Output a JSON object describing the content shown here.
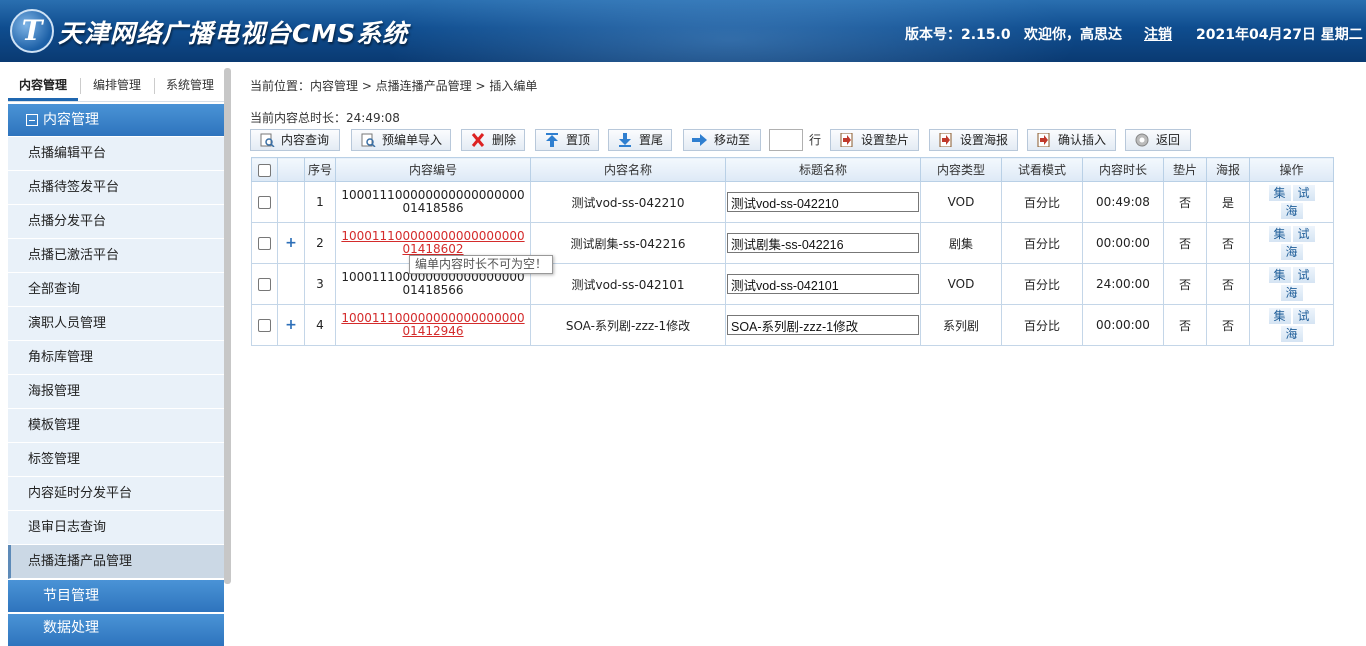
{
  "header": {
    "logo_letter": "T",
    "title": "天津网络广播电视台CMS系统",
    "version_label": "版本号：2.15.0",
    "welcome": "欢迎你，高思达",
    "logout": "注销",
    "date": "2021年04月27日 星期二"
  },
  "sidebar": {
    "tabs": [
      "内容管理",
      "编排管理",
      "系统管理"
    ],
    "active_tab": "内容管理",
    "group_title": "内容管理",
    "items": [
      "点播编辑平台",
      "点播待签发平台",
      "点播分发平台",
      "点播已激活平台",
      "全部查询",
      "演职人员管理",
      "角标库管理",
      "海报管理",
      "模板管理",
      "标签管理",
      "内容延时分发平台",
      "退审日志查询",
      "点播连播产品管理"
    ],
    "active_item": "点播连播产品管理",
    "group2_title": "节目管理",
    "group3_title": "数据处理"
  },
  "main": {
    "breadcrumb": "当前位置：内容管理 > 点播连播产品管理 > 插入编单",
    "total_duration": "当前内容总时长：24:49:08",
    "toolbar": {
      "query": "内容查询",
      "import": "预编单导入",
      "delete": "删除",
      "top": "置顶",
      "bottom": "置尾",
      "move_to": "移动至",
      "row_unit": "行",
      "set_pad": "设置垫片",
      "set_poster": "设置海报",
      "confirm_insert": "确认插入",
      "back": "返回"
    },
    "columns": [
      "",
      "",
      "序号",
      "内容编号",
      "内容名称",
      "标题名称",
      "内容类型",
      "试看模式",
      "内容时长",
      "垫片",
      "海报",
      "操作"
    ],
    "rows": [
      {
        "seq": "1",
        "code": "10001110000000000000000001418586",
        "name": "测试vod-ss-042210",
        "title": "测试vod-ss-042210",
        "type": "VOD",
        "mode": "百分比",
        "duration": "00:49:08",
        "pad": "否",
        "poster": "是"
      },
      {
        "seq": "2",
        "code": "10001110000000000000000001418602",
        "name": "测试剧集-ss-042216",
        "title": "测试剧集-ss-042216",
        "type": "剧集",
        "mode": "百分比",
        "duration": "00:00:00",
        "pad": "否",
        "poster": "否"
      },
      {
        "seq": "3",
        "code": "10001110000000000000000001418566",
        "name": "测试vod-ss-042101",
        "title": "测试vod-ss-042101",
        "type": "VOD",
        "mode": "百分比",
        "duration": "24:00:00",
        "pad": "否",
        "poster": "否"
      },
      {
        "seq": "4",
        "code": "10001110000000000000000001412946",
        "name": "SOA-系列剧-zzz-1修改",
        "title": "SOA-系列剧-zzz-1修改",
        "type": "系列剧",
        "mode": "百分比",
        "duration": "00:00:00",
        "pad": "否",
        "poster": "否"
      }
    ],
    "op_labels": {
      "episode": "集",
      "trial": "试",
      "poster": "海"
    },
    "tooltip": "编单内容时长不可为空！"
  },
  "colors": {
    "header_bg": "#0f4d8f",
    "accent": "#2e74bd",
    "link_red": "#d42b2b"
  }
}
